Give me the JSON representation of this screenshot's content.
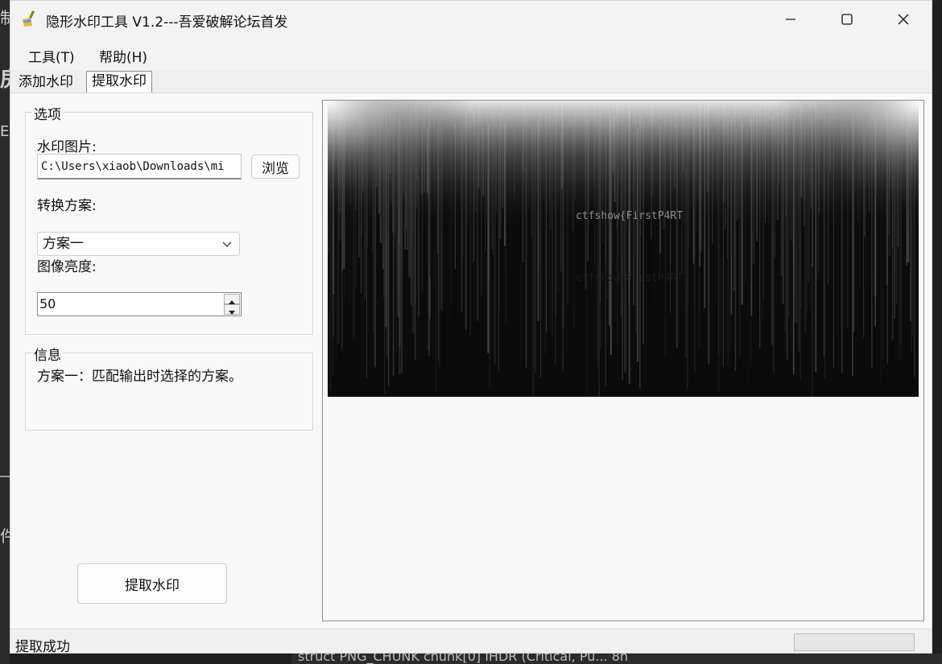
{
  "window": {
    "title": "隐形水印工具 V1.2---吾爱破解论坛首发"
  },
  "menu": {
    "items": [
      {
        "label": "工具(T)"
      },
      {
        "label": "帮助(H)"
      }
    ]
  },
  "tabs": [
    {
      "label": "添加水印",
      "active": false
    },
    {
      "label": "提取水印",
      "active": true
    }
  ],
  "options": {
    "group_title": "选项",
    "watermark_image_label": "水印图片:",
    "watermark_image_path": "C:\\Users\\xiaob\\Downloads\\mi",
    "browse_label": "浏览",
    "scheme_label": "转换方案:",
    "scheme_selected": "方案一",
    "brightness_label": "图像亮度:",
    "brightness_value": "50"
  },
  "info": {
    "group_title": "信息",
    "text": "方案一：匹配输出时选择的方案。"
  },
  "extract_button_label": "提取水印",
  "preview": {
    "watermark_text": "ctfshow{FirstP4RT",
    "watermark_text_ghost": "ctfshow{FirstP4RT"
  },
  "status": {
    "text": "提取成功",
    "progress": 0
  },
  "background": {
    "bottom_text": "struct PNG_CHUNK chunk[0]        IHDR  (Critical, Pu...  8h",
    "left_glyphs": [
      "制",
      "房",
      "Ec",
      "件"
    ]
  },
  "colors": {
    "window_bg": "#f0f0f0",
    "page_bg": "#f9f9f9",
    "close_hover": "#c42b1c",
    "progress_green": "#06b025"
  }
}
